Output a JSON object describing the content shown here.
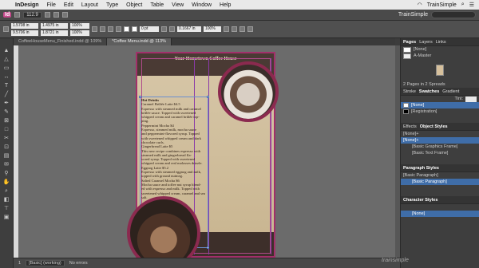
{
  "menubar": {
    "items": [
      "InDesign",
      "File",
      "Edit",
      "Layout",
      "Type",
      "Object",
      "Table",
      "View",
      "Window",
      "Help"
    ],
    "right_text": "TrainSimple"
  },
  "appbar": {
    "badge": "Id",
    "zoom": "112.9",
    "workspace": "TrainSimple"
  },
  "control": {
    "x_value": "1.5708 in",
    "y_value": "9.5706 in",
    "w_value": "1.4975 in",
    "h_value": "1.8721 in",
    "pct1": "100%",
    "pct2": "100%",
    "stroke_pt": "0 pt",
    "offset": "0.1667 in",
    "pct3": "100%"
  },
  "tabs": [
    {
      "label": "CoffeeHouseMenu_Finished.indd @ 109%"
    },
    {
      "label": "*Coffee Menu.indd @ 113%"
    }
  ],
  "page": {
    "banner_title": "Your Hometown Coffee House",
    "menu_lines": [
      "Hot Drinks",
      "Caramel Brûlée Latte  $4.5",
      "Espresso with steamed milk and caramel",
      "brûlée sauce. Topped with sweetened",
      "whipped cream and caramel brûlée top-",
      "ping.",
      "Peppermint Mocha    $4",
      "Espresso, steamed milk, mocha sauce",
      "and peppermint-flavored syrup. Topped",
      "with sweetened whipped cream and dark",
      "chocolate curls.",
      "Gingerbread Latte      $5",
      "This new recipe combines espresso with",
      "steamed milk and gingerbread fla-",
      "vored syrup. Topped with sweetened",
      "whipped cream and real molasses drizzle.",
      "Eggnog Latte    $5.2",
      "Espresso with steamed eggnog and milk,",
      "topped with ground nutmeg.",
      "Salted Caramel Mocha           $6",
      "Mocha sauce and toffee nut syrup blend-",
      "ed with espresso and milk. Topped with",
      "sweetened whipped cream, caramel and sea",
      "salt."
    ]
  },
  "status": {
    "page": "1",
    "master": "[Basic] (working)",
    "errors": "No errors"
  },
  "panels": {
    "pages_tabs": [
      "Pages",
      "Layers",
      "Links"
    ],
    "none_row": "[None]",
    "master_row": "A-Master",
    "pages_info": "2 Pages in 2 Spreads",
    "swatch_tabs": [
      "Stroke",
      "Swatches",
      "Gradient"
    ],
    "tint_label": "Tint:",
    "swatches": [
      "[None]",
      "[Registration]"
    ],
    "obj_tabs": [
      "Effects",
      "Object Styles"
    ],
    "obj_items": [
      "[None]+",
      "[Basic Graphics Frame]",
      "[Basic Text Frame]"
    ],
    "para_header": "Paragraph Styles",
    "para_items": [
      "[Basic Paragraph]",
      "[Basic Paragraph]"
    ],
    "char_header": "Character Styles",
    "char_items": [
      "[None]"
    ]
  },
  "watermark": "trainsimple"
}
